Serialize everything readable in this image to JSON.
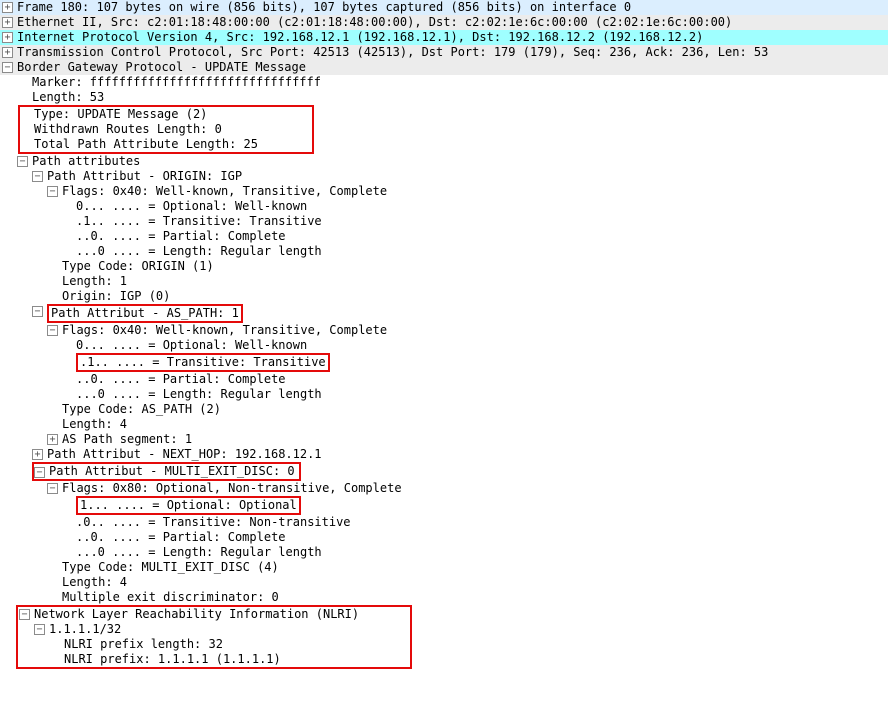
{
  "frame": {
    "summary": "Frame 180: 107 bytes on wire (856 bits), 107 bytes captured (856 bits) on interface 0"
  },
  "ethernet": {
    "summary": "Ethernet II, Src: c2:01:18:48:00:00 (c2:01:18:48:00:00), Dst: c2:02:1e:6c:00:00 (c2:02:1e:6c:00:00)"
  },
  "ip": {
    "summary": "Internet Protocol Version 4, Src: 192.168.12.1 (192.168.12.1), Dst: 192.168.12.2 (192.168.12.2)"
  },
  "tcp": {
    "summary": "Transmission Control Protocol, Src Port: 42513 (42513), Dst Port: 179 (179), Seq: 236, Ack: 236, Len: 53"
  },
  "bgp": {
    "title": "Border Gateway Protocol - UPDATE Message",
    "marker": "Marker: ffffffffffffffffffffffffffffffff",
    "length": "Length: 53",
    "type": "Type: UPDATE Message (2)",
    "withdrawn": "Withdrawn Routes Length: 0",
    "totalpath": "Total Path Attribute Length: 25",
    "pathattrs": "Path attributes",
    "origin": {
      "title": "Path Attribut - ORIGIN: IGP",
      "flags": "Flags: 0x40: Well-known, Transitive, Complete",
      "b0": "0... .... = Optional: Well-known",
      "b1": ".1.. .... = Transitive: Transitive",
      "b2": "..0. .... = Partial: Complete",
      "b3": "...0 .... = Length: Regular length",
      "typecode": "Type Code: ORIGIN (1)",
      "len": "Length: 1",
      "val": "Origin: IGP (0)"
    },
    "aspath": {
      "title": "Path Attribut - AS_PATH: 1",
      "flags": "Flags: 0x40: Well-known, Transitive, Complete",
      "b0": "0... .... = Optional: Well-known",
      "b1": ".1.. .... = Transitive: Transitive",
      "b2": "..0. .... = Partial: Complete",
      "b3": "...0 .... = Length: Regular length",
      "typecode": "Type Code: AS_PATH (2)",
      "len": "Length: 4",
      "seg": "AS Path segment: 1"
    },
    "nexthop": {
      "title": "Path Attribut - NEXT_HOP: 192.168.12.1"
    },
    "med": {
      "title": "Path Attribut - MULTI_EXIT_DISC: 0",
      "flags": "Flags: 0x80: Optional, Non-transitive, Complete",
      "b0": "1... .... = Optional: Optional",
      "b1": ".0.. .... = Transitive: Non-transitive",
      "b2": "..0. .... = Partial: Complete",
      "b3": "...0 .... = Length: Regular length",
      "typecode": "Type Code: MULTI_EXIT_DISC (4)",
      "len": "Length: 4",
      "val": "Multiple exit discriminator: 0"
    },
    "nlri": {
      "title": "Network Layer Reachability Information (NLRI)",
      "prefix": "1.1.1.1/32",
      "plen": "NLRI prefix length: 32",
      "pval": "NLRI prefix: 1.1.1.1 (1.1.1.1)"
    }
  }
}
